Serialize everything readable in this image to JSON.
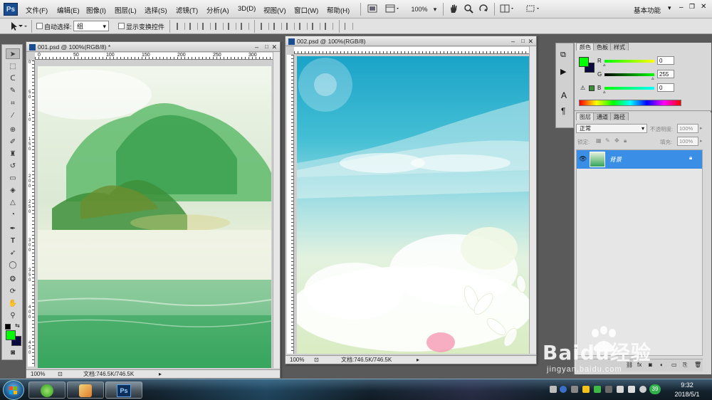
{
  "app": {
    "logo": "Ps"
  },
  "menubar": {
    "items": [
      "文件(F)",
      "编辑(E)",
      "图像(I)",
      "图层(L)",
      "选择(S)",
      "滤镜(T)",
      "分析(A)",
      "3D(D)",
      "视图(V)",
      "窗口(W)",
      "帮助(H)"
    ],
    "zoom": "100%",
    "workspace": "基本功能"
  },
  "options": {
    "auto_select_label": "自动选择:",
    "auto_select_value": "组",
    "show_transform_label": "显示变换控件"
  },
  "doc1": {
    "title": "001.psd @ 100%(RGB/8) *",
    "ruler_h": [
      "0",
      "50",
      "100",
      "150",
      "200",
      "250",
      "300"
    ],
    "ruler_v": [
      "0",
      "5",
      "0",
      "1",
      "0",
      "1",
      "5",
      "0",
      "2",
      "0",
      "0",
      "2",
      "5",
      "0",
      "3",
      "0",
      "0",
      "3",
      "5",
      "0",
      "4",
      "0",
      "0",
      "4",
      "5",
      "0"
    ],
    "zoom": "100%",
    "doc_info": "文档:746.5K/746.5K"
  },
  "doc2": {
    "title": "002.psd @ 100%(RGB/8)",
    "zoom": "100%",
    "doc_info": "文档:746.5K/746.5K"
  },
  "color_panel": {
    "tabs": [
      "颜色",
      "色板",
      "样式"
    ],
    "r_label": "R",
    "r_value": "0",
    "g_label": "G",
    "g_value": "255",
    "b_label": "B",
    "b_value": "0",
    "fg_color": "#00ff00",
    "bg_color": "#0a0a40"
  },
  "layers_panel": {
    "tabs": [
      "图层",
      "通道",
      "路径"
    ],
    "blend_mode": "正常",
    "opacity_label": "不透明度:",
    "opacity_value": "100%",
    "lock_label": "锁定:",
    "fill_label": "填充:",
    "fill_value": "100%",
    "layer_name": "背景"
  },
  "watermark": {
    "brand": "Baidu经验",
    "url": "jingyan.baidu.com"
  },
  "taskbar": {
    "clock_time": "9:32",
    "clock_date": "2018/5/1",
    "badge": "39",
    "ps_label": "Ps"
  }
}
